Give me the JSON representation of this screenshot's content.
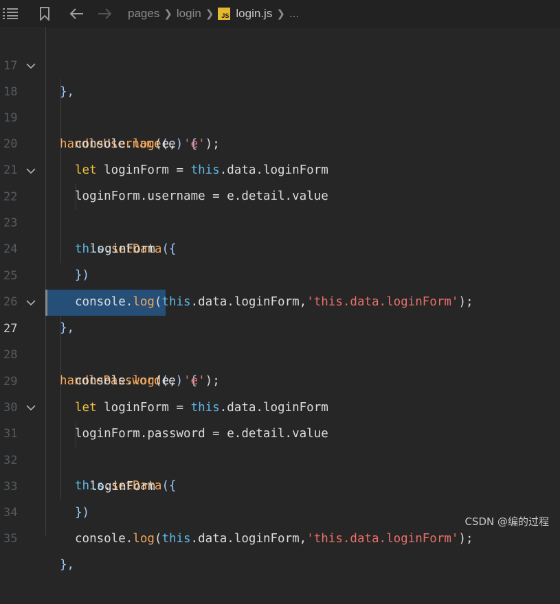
{
  "toolbar": {
    "breadcrumbs": [
      "pages",
      "login"
    ],
    "file_badge": "JS",
    "file_name": "login.js",
    "ellipsis": "..."
  },
  "editor": {
    "active_line": "27",
    "selected_text": "handlePassword",
    "lines": [
      {
        "n": "17",
        "text": "},"
      },
      {
        "n": "18",
        "text": "handleUsername(e) {"
      },
      {
        "n": "19",
        "text": "console.log(e, 'e');"
      },
      {
        "n": "20",
        "text": "let loginForm = this.data.loginForm"
      },
      {
        "n": "21",
        "text": "loginForm.username = e.detail.value"
      },
      {
        "n": "22",
        "text": "this.setData({"
      },
      {
        "n": "23",
        "text": "loginForm"
      },
      {
        "n": "24",
        "text": "})"
      },
      {
        "n": "25",
        "text": "console.log(this.data.loginForm,'this.data.loginForm');"
      },
      {
        "n": "26",
        "text": "},"
      },
      {
        "n": "27",
        "text": "handlePassword(e) {"
      },
      {
        "n": "28",
        "text": "console.log(e, 'e');"
      },
      {
        "n": "29",
        "text": "let loginForm = this.data.loginForm"
      },
      {
        "n": "30",
        "text": "loginForm.password = e.detail.value"
      },
      {
        "n": "31",
        "text": "this.setData({"
      },
      {
        "n": "32",
        "text": "loginForm"
      },
      {
        "n": "33",
        "text": "})"
      },
      {
        "n": "34",
        "text": "console.log(this.data.loginForm,'this.data.loginForm');"
      },
      {
        "n": "35",
        "text": "},"
      }
    ]
  },
  "watermark": "CSDN @编的过程",
  "colors": {
    "background": "#262626",
    "keyword": "#f0c23d",
    "function": "#f2a65a",
    "this": "#5fb8e8",
    "string": "#e8706a",
    "selection": "#264f78"
  }
}
